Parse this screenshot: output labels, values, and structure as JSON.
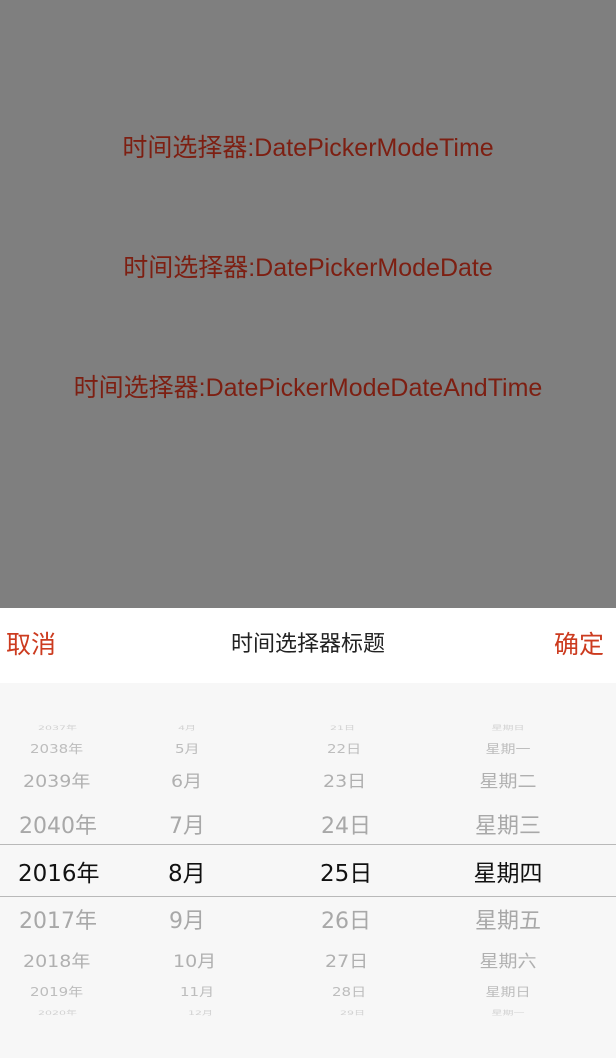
{
  "modes": [
    {
      "label": "时间选择器:DatePickerModeTime"
    },
    {
      "label": "时间选择器:DatePickerModeDate"
    },
    {
      "label": "时间选择器:DatePickerModeDateAndTime"
    }
  ],
  "toolbar": {
    "cancel_label": "取消",
    "title": "时间选择器标题",
    "confirm_label": "确定"
  },
  "picker": {
    "years": [
      "2037年",
      "2038年",
      "2039年",
      "2040年",
      "2016年",
      "2017年",
      "2018年",
      "2019年",
      "2020年"
    ],
    "months": [
      "4月",
      "5月",
      "6月",
      "7月",
      "8月",
      "9月",
      "10月",
      "11月",
      "12月"
    ],
    "days": [
      "21日",
      "22日",
      "23日",
      "24日",
      "25日",
      "26日",
      "27日",
      "28日",
      "29日"
    ],
    "weekdays": [
      "星期日",
      "星期一",
      "星期二",
      "星期三",
      "星期四",
      "星期五",
      "星期六",
      "星期日",
      "星期一"
    ]
  },
  "colors": {
    "overlay": "#7f7f7f",
    "mode_text": "#7d1f12",
    "accent": "#cc3b1f",
    "selected_text": "#111111",
    "unselected_text": "#a8a8a8"
  }
}
